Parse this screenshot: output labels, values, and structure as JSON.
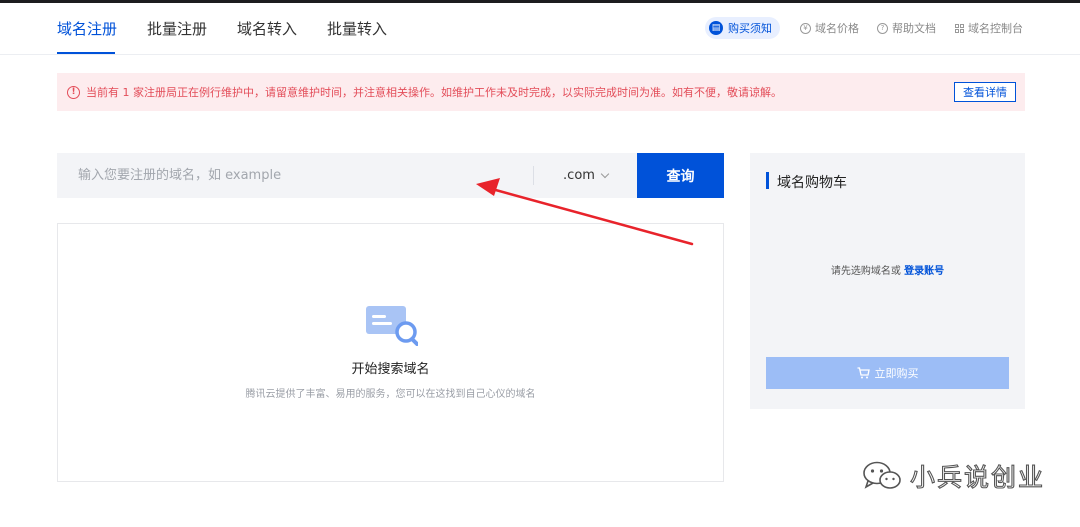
{
  "tabs": [
    {
      "label": "域名注册",
      "active": true
    },
    {
      "label": "批量注册",
      "active": false
    },
    {
      "label": "域名转入",
      "active": false
    },
    {
      "label": "批量转入",
      "active": false
    }
  ],
  "header_links": {
    "purchase_notice": "购买须知",
    "domain_price": "域名价格",
    "help_docs": "帮助文档",
    "console": "域名控制台"
  },
  "notice": {
    "message": "当前有 1 家注册局正在例行维护中，请留意维护时间，并注意相关操作。如维护工作未及时完成，以实际完成时间为准。如有不便，敬请谅解。",
    "detail_button": "查看详情"
  },
  "search": {
    "placeholder": "输入您要注册的域名，如 example",
    "value": "",
    "suffix": ".com",
    "button": "查询"
  },
  "results": {
    "title": "开始搜索域名",
    "subtitle": "腾讯云提供了丰富、易用的服务，您可以在这找到自己心仪的域名"
  },
  "cart": {
    "title": "域名购物车",
    "empty_prefix": "请先选购域名或",
    "login_link": "登录账号",
    "buy_button": "立即购买"
  },
  "watermark": {
    "text": "小兵说创业"
  },
  "colors": {
    "brand": "#0052d9",
    "warning": "#e34d59",
    "annotation_arrow": "#e8232b"
  }
}
